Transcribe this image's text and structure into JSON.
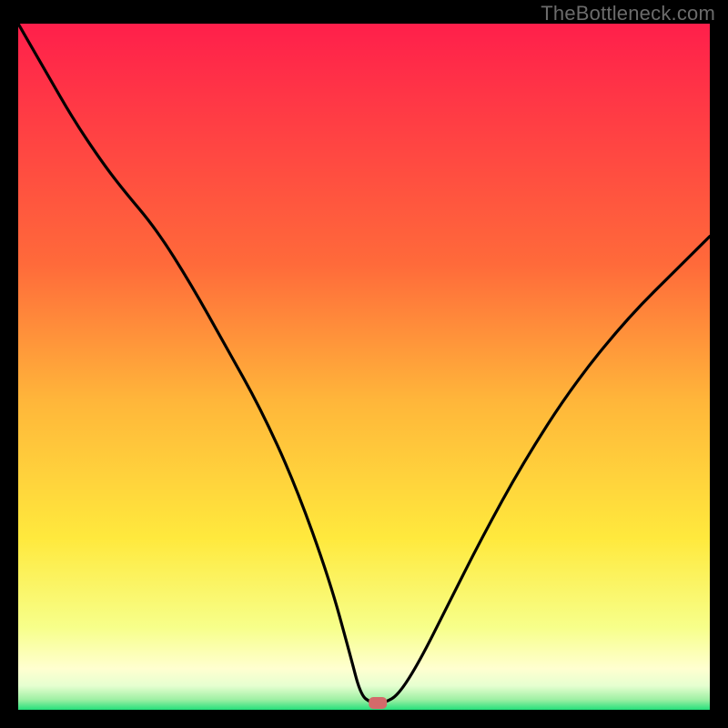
{
  "watermark": "TheBottleneck.com",
  "chart_data": {
    "type": "line",
    "title": "",
    "xlabel": "",
    "ylabel": "",
    "xlim": [
      0,
      100
    ],
    "ylim": [
      0,
      100
    ],
    "grid": false,
    "legend": false,
    "background_gradient": {
      "stops": [
        {
          "offset": 0.0,
          "color": "#ff1f4b"
        },
        {
          "offset": 0.35,
          "color": "#ff6a3a"
        },
        {
          "offset": 0.55,
          "color": "#ffb63a"
        },
        {
          "offset": 0.75,
          "color": "#ffe93d"
        },
        {
          "offset": 0.88,
          "color": "#f7ff8a"
        },
        {
          "offset": 0.94,
          "color": "#ffffd0"
        },
        {
          "offset": 0.965,
          "color": "#e6ffd0"
        },
        {
          "offset": 0.985,
          "color": "#9ff0a4"
        },
        {
          "offset": 1.0,
          "color": "#25e07b"
        }
      ]
    },
    "annotations": [
      {
        "type": "marker",
        "shape": "rounded-rect",
        "x": 52,
        "y": 1.0,
        "color": "#d36a6a"
      }
    ],
    "series": [
      {
        "name": "bottleneck-curve",
        "x": [
          0,
          4,
          8,
          12,
          15,
          20,
          25,
          30,
          35,
          40,
          45,
          48,
          49.5,
          51,
          53,
          55,
          58,
          62,
          67,
          73,
          80,
          88,
          96,
          100
        ],
        "y": [
          100,
          93,
          86,
          80,
          76,
          70,
          62,
          53,
          44,
          33,
          19,
          8,
          2.2,
          1.0,
          1.0,
          2.2,
          7,
          15,
          25,
          36,
          47,
          57,
          65,
          69
        ]
      }
    ]
  }
}
